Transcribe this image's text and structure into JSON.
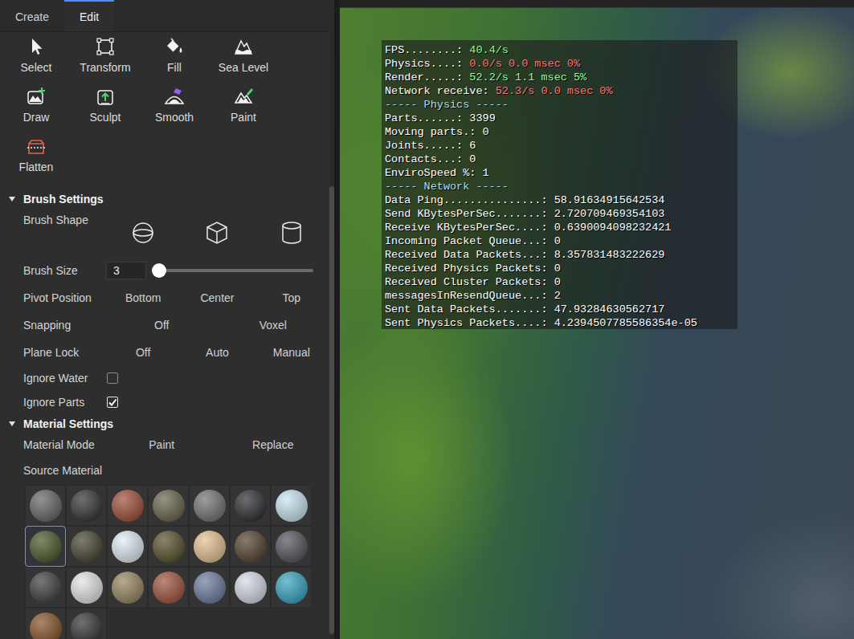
{
  "tabs": [
    {
      "label": "Create",
      "selected": false
    },
    {
      "label": "Edit",
      "selected": true
    }
  ],
  "tools": [
    {
      "label": "Select",
      "kind": "select",
      "selected": false
    },
    {
      "label": "Transform",
      "kind": "transform",
      "selected": false
    },
    {
      "label": "Fill",
      "kind": "fill",
      "selected": false
    },
    {
      "label": "Sea Level",
      "kind": "sealevel",
      "selected": false
    },
    {
      "label": "Draw",
      "kind": "draw",
      "selected": false
    },
    {
      "label": "Sculpt",
      "kind": "sculpt",
      "selected": false
    },
    {
      "label": "Smooth",
      "kind": "smooth",
      "selected": false
    },
    {
      "label": "Paint",
      "kind": "paint",
      "selected": false
    },
    {
      "label": "Flatten",
      "kind": "flatten",
      "selected": false
    }
  ],
  "brush_settings": {
    "title": "Brush Settings",
    "expanded": true,
    "shape": {
      "label": "Brush Shape",
      "options": [
        {
          "kind": "sphere",
          "selected": false
        },
        {
          "kind": "cube",
          "selected": false
        },
        {
          "kind": "cylinder",
          "selected": false
        }
      ]
    },
    "size": {
      "label": "Brush Size",
      "value": "3",
      "level": 0.04
    },
    "pivot": {
      "label": "Pivot Position",
      "options": [
        {
          "label": "Bottom",
          "selected": false
        },
        {
          "label": "Center",
          "selected": false
        },
        {
          "label": "Top",
          "selected": false
        }
      ]
    },
    "snapping": {
      "label": "Snapping",
      "options": [
        {
          "label": "Off",
          "selected": false
        },
        {
          "label": "Voxel",
          "selected": false
        }
      ]
    },
    "plane_lock": {
      "label": "Plane Lock",
      "options": [
        {
          "label": "Off",
          "selected": false
        },
        {
          "label": "Auto",
          "selected": false
        },
        {
          "label": "Manual",
          "selected": false
        }
      ]
    },
    "ignore_water": {
      "label": "Ignore Water",
      "checked": false
    },
    "ignore_parts": {
      "label": "Ignore Parts",
      "checked": true
    }
  },
  "material_settings": {
    "title": "Material Settings",
    "expanded": true,
    "mode": {
      "label": "Material Mode",
      "options": [
        {
          "label": "Paint",
          "selected": false
        },
        {
          "label": "Replace",
          "selected": false
        }
      ]
    },
    "source": {
      "label": "Source Material",
      "materials": [
        {
          "color": "#6b6b6b",
          "selected": false
        },
        {
          "color": "#3a3a38",
          "selected": false
        },
        {
          "color": "#a4543f",
          "selected": false
        },
        {
          "color": "#6f6a52",
          "selected": false
        },
        {
          "color": "#787878",
          "selected": false
        },
        {
          "color": "#35353a",
          "selected": false
        },
        {
          "color": "#c9e6f0",
          "selected": false
        },
        {
          "color": "#4f5e30",
          "selected": true
        },
        {
          "color": "#4b4a38",
          "selected": false
        },
        {
          "color": "#e2eef6",
          "selected": false
        },
        {
          "color": "#5b5733",
          "selected": false
        },
        {
          "color": "#e6c596",
          "selected": false
        },
        {
          "color": "#5a4937",
          "selected": false
        },
        {
          "color": "#595a62",
          "selected": false
        },
        {
          "color": "#444448",
          "selected": false
        },
        {
          "color": "#e6e6e6",
          "selected": false
        },
        {
          "color": "#9a8a66",
          "selected": false
        },
        {
          "color": "#a35a45",
          "selected": false
        },
        {
          "color": "#7181a2",
          "selected": false
        },
        {
          "color": "#d7dce8",
          "selected": false
        },
        {
          "color": "#3fa8c2",
          "selected": false
        },
        {
          "color": "#8a5a30",
          "selected": false
        },
        {
          "color": "#3b3b3c",
          "selected": false
        }
      ]
    }
  },
  "stats": {
    "lines": [
      {
        "kind": "row",
        "label": "FPS........: ",
        "value": "40.4/s",
        "color": "#8cff8c"
      },
      {
        "kind": "row",
        "label": "Physics....: ",
        "value": "0.0/s 0.0 msec 0%",
        "color": "#ff7878"
      },
      {
        "kind": "row",
        "label": "Render.....: ",
        "value": "52.2/s 1.1 msec 5%",
        "color": "#8cff8c"
      },
      {
        "kind": "row",
        "label": "Network receive: ",
        "value": "52.3/s 0.0 msec 0%",
        "color": "#ff7878"
      },
      {
        "kind": "header",
        "text": "----- Physics -----",
        "color": "#a8dcff"
      },
      {
        "kind": "row",
        "label": "Parts......: ",
        "value": "3399",
        "color": "#ffffff"
      },
      {
        "kind": "row",
        "label": "Moving parts.: ",
        "value": "0",
        "color": "#ffffff"
      },
      {
        "kind": "row",
        "label": "Joints.....: ",
        "value": "6",
        "color": "#ffffff"
      },
      {
        "kind": "row",
        "label": "Contacts...: ",
        "value": "0",
        "color": "#ffffff"
      },
      {
        "kind": "row",
        "label": "EnviroSpeed %: ",
        "value": "1",
        "color": "#ffffff"
      },
      {
        "kind": "header",
        "text": "----- Network -----",
        "color": "#a8dcff"
      },
      {
        "kind": "row",
        "label": "Data Ping...............: ",
        "value": "58.91634915642534",
        "color": "#ffffff"
      },
      {
        "kind": "row",
        "label": "Send KBytesPerSec.......: ",
        "value": "2.720709469354103",
        "color": "#ffffff"
      },
      {
        "kind": "row",
        "label": "Receive KBytesPerSec....: ",
        "value": "0.6390094098232421",
        "color": "#ffffff"
      },
      {
        "kind": "row",
        "label": "Incoming Packet Queue...: ",
        "value": "0",
        "color": "#ffffff"
      },
      {
        "kind": "row",
        "label": "Received Data Packets...: ",
        "value": "8.357831483222629",
        "color": "#ffffff"
      },
      {
        "kind": "row",
        "label": "Received Physics Packets: ",
        "value": "0",
        "color": "#ffffff"
      },
      {
        "kind": "row",
        "label": "Received Cluster Packets: ",
        "value": "0",
        "color": "#ffffff"
      },
      {
        "kind": "row",
        "label": "messagesInResendQueue...: ",
        "value": "2",
        "color": "#ffffff"
      },
      {
        "kind": "row",
        "label": "Sent Data Packets.......: ",
        "value": "47.93284630562717",
        "color": "#ffffff"
      },
      {
        "kind": "row",
        "label": "Sent Physics Packets....: ",
        "value": "4.2394507785586354e-05",
        "color": "#ffffff"
      }
    ]
  }
}
